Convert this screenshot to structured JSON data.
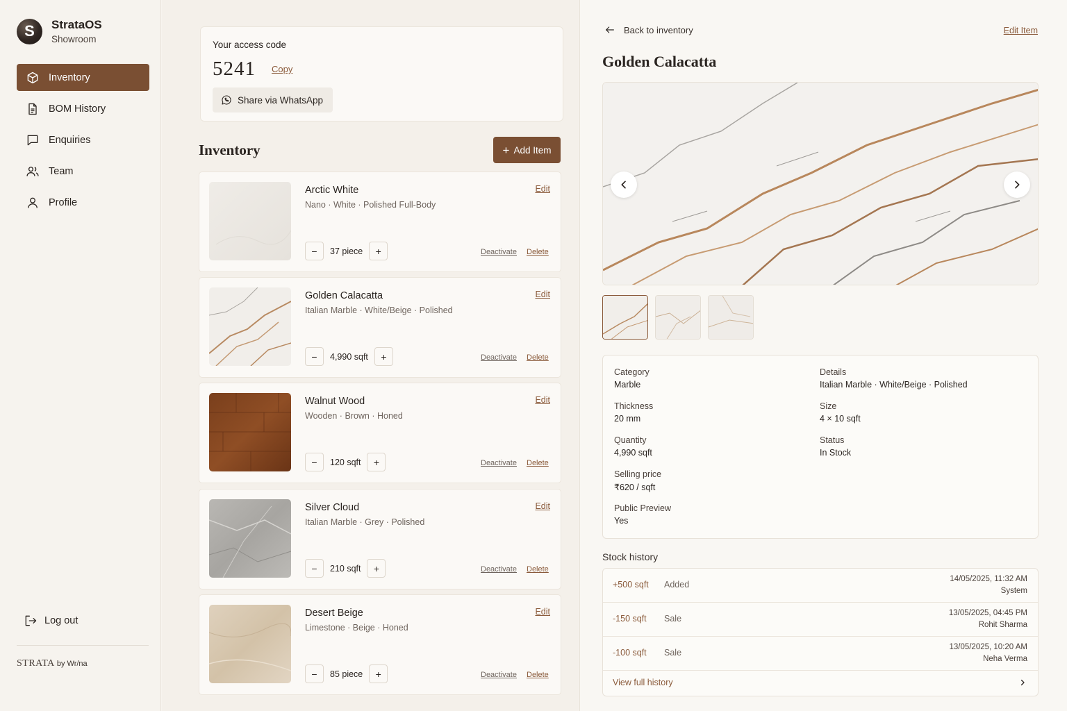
{
  "brand": {
    "initial": "S",
    "name": "StrataOS",
    "subtitle": "Showroom"
  },
  "nav": [
    {
      "label": "Inventory",
      "icon": "box-icon",
      "active": true
    },
    {
      "label": "BOM History",
      "icon": "document-icon"
    },
    {
      "label": "Enquiries",
      "icon": "chat-icon"
    },
    {
      "label": "Team",
      "icon": "users-icon"
    },
    {
      "label": "Profile",
      "icon": "user-icon"
    }
  ],
  "logout_label": "Log out",
  "footer": {
    "brand": "STRATA",
    "by": "by Wr/na"
  },
  "access": {
    "label": "Your access code",
    "code": "5241",
    "copy_label": "Copy",
    "share_label": "Share via WhatsApp"
  },
  "inventory": {
    "title": "Inventory",
    "add_label": "Add Item",
    "edit_label": "Edit",
    "deactivate_label": "Deactivate",
    "delete_label": "Delete",
    "items": [
      {
        "name": "Arctic White",
        "desc": "Nano · White · Polished Full-Body",
        "qty": "37 piece"
      },
      {
        "name": "Golden Calacatta",
        "desc": "Italian Marble · White/Beige · Polished",
        "qty": "4,990 sqft"
      },
      {
        "name": "Walnut Wood",
        "desc": "Wooden · Brown · Honed",
        "qty": "120 sqft"
      },
      {
        "name": "Silver Cloud",
        "desc": "Italian Marble · Grey · Polished",
        "qty": "210 sqft"
      },
      {
        "name": "Desert Beige",
        "desc": "Limestone · Beige · Honed",
        "qty": "85 piece"
      }
    ]
  },
  "detail": {
    "back_label": "Back to inventory",
    "edit_label": "Edit Item",
    "title": "Golden Calacatta",
    "fields": {
      "category": {
        "label": "Category",
        "value": "Marble"
      },
      "details": {
        "label": "Details",
        "value": "Italian Marble · White/Beige · Polished"
      },
      "thickness": {
        "label": "Thickness",
        "value": "20 mm"
      },
      "size": {
        "label": "Size",
        "value": "4 × 10 sqft"
      },
      "quantity": {
        "label": "Quantity",
        "value": "4,990 sqft"
      },
      "status": {
        "label": "Status",
        "value": "In Stock"
      },
      "price": {
        "label": "Selling price",
        "value": "₹620 / sqft"
      },
      "preview": {
        "label": "Public Preview",
        "value": "Yes"
      }
    }
  },
  "stock_history": {
    "title": "Stock history",
    "rows": [
      {
        "qty": "+500 sqft",
        "type": "Added",
        "date": "14/05/2025, 11:32 AM",
        "by": "System"
      },
      {
        "qty": "-150 sqft",
        "type": "Sale",
        "date": "13/05/2025, 04:45 PM",
        "by": "Rohit Sharma"
      },
      {
        "qty": "-100 sqft",
        "type": "Sale",
        "date": "13/05/2025, 10:20 AM",
        "by": "Neha Verma"
      }
    ],
    "view_all_label": "View full history"
  },
  "colors": {
    "accent": "#7a4f33",
    "link": "#8a5a3a",
    "background": "#f7f4ef"
  }
}
